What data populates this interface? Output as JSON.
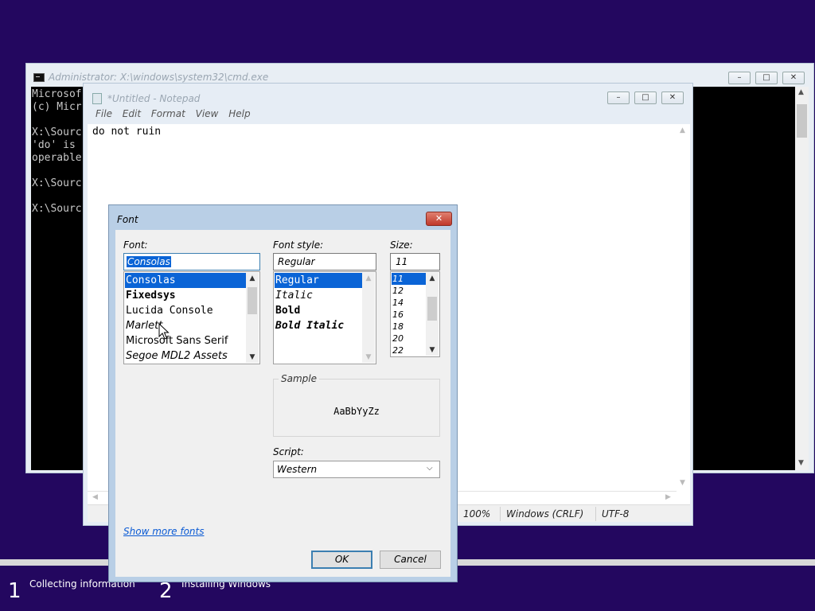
{
  "cmd": {
    "title": "Administrator: X:\\windows\\system32\\cmd.exe",
    "lines": [
      "Microsof",
      "(c) Micr",
      "",
      "X:\\Sourc",
      "'do' is",
      "operable",
      "",
      "X:\\Sourc",
      "",
      "X:\\Sourc"
    ]
  },
  "notepad": {
    "title": "*Untitled - Notepad",
    "menu": [
      "File",
      "Edit",
      "Format",
      "View",
      "Help"
    ],
    "content": "do not ruin",
    "status": {
      "zoom": "100%",
      "line_ending": "Windows (CRLF)",
      "encoding": "UTF-8"
    }
  },
  "font_dialog": {
    "title": "Font",
    "font_label": "Font:",
    "font_value": "Consolas",
    "fonts": [
      "Consolas",
      "Fixedsys",
      "Lucida Console",
      "Marlett",
      "Microsoft Sans Serif",
      "Segoe MDL2 Assets"
    ],
    "style_label": "Font style:",
    "style_value": "Regular",
    "styles": [
      "Regular",
      "Italic",
      "Bold",
      "Bold Italic"
    ],
    "size_label": "Size:",
    "size_value": "11",
    "sizes": [
      "11",
      "12",
      "14",
      "16",
      "18",
      "20",
      "22"
    ],
    "sample_label": "Sample",
    "sample_text": "AaBbYyZz",
    "script_label": "Script:",
    "script_value": "Western",
    "show_more": "Show more fonts",
    "ok": "OK",
    "cancel": "Cancel"
  },
  "setup": {
    "steps": [
      {
        "num": "1",
        "label": "Collecting information"
      },
      {
        "num": "2",
        "label": "Installing Windows"
      }
    ]
  },
  "colors": {
    "desktop": "#23075f",
    "selection": "#0a64d6",
    "progress": "#1fa22a"
  }
}
